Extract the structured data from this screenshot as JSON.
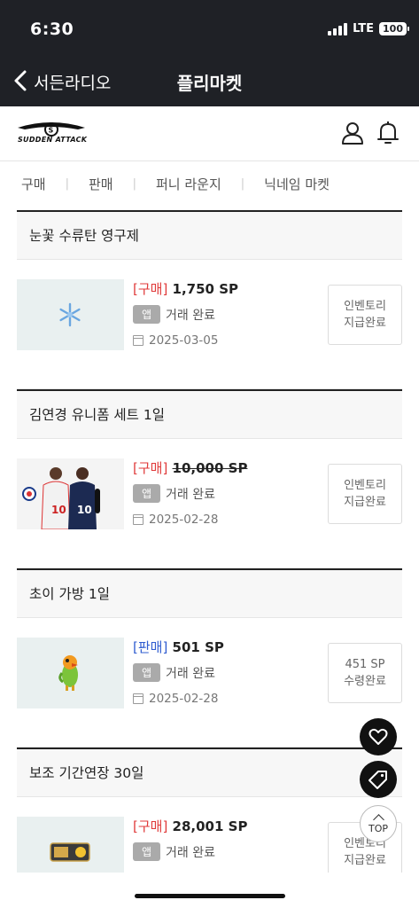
{
  "status_bar": {
    "time": "6:30",
    "network": "LTE",
    "battery": "100"
  },
  "nav": {
    "back_label": "서든라디오",
    "title": "플리마켓"
  },
  "header": {
    "logo_text": "SUDDEN ATTACK"
  },
  "tabs": [
    {
      "label": "구매"
    },
    {
      "label": "판매"
    },
    {
      "label": "퍼니 라운지"
    },
    {
      "label": "닉네임 마켓"
    }
  ],
  "items": [
    {
      "name": "눈꽃 수류탄 영구제",
      "type_tag": "[구매]",
      "price": "1,750 SP",
      "app_badge": "앱",
      "trade_status": "거래 완료",
      "date": "2025-03-05",
      "status_line1": "인벤토리",
      "status_line2": "지급완료"
    },
    {
      "name": "김연경 유니폼 세트 1일",
      "type_tag": "[구매]",
      "price": "10,000 SP",
      "app_badge": "앱",
      "trade_status": "거래 완료",
      "date": "2025-02-28",
      "status_line1": "인벤토리",
      "status_line2": "지급완료"
    },
    {
      "name": "초이 가방 1일",
      "type_tag": "[판매]",
      "price": "501 SP",
      "app_badge": "앱",
      "trade_status": "거래 완료",
      "date": "2025-02-28",
      "status_line1": "451 SP",
      "status_line2": "수령완료"
    },
    {
      "name": "보조 기간연장 30일",
      "type_tag": "[구매]",
      "price": "28,001 SP",
      "app_badge": "앱",
      "trade_status": "거래 완료",
      "date": "",
      "status_line1": "인벤토리",
      "status_line2": "지급완료"
    }
  ],
  "fab": {
    "top_label": "TOP"
  },
  "colors": {
    "dark_bar": "#1f2126",
    "buy_tag": "#e03a3a",
    "sell_tag": "#2f5cd0"
  }
}
